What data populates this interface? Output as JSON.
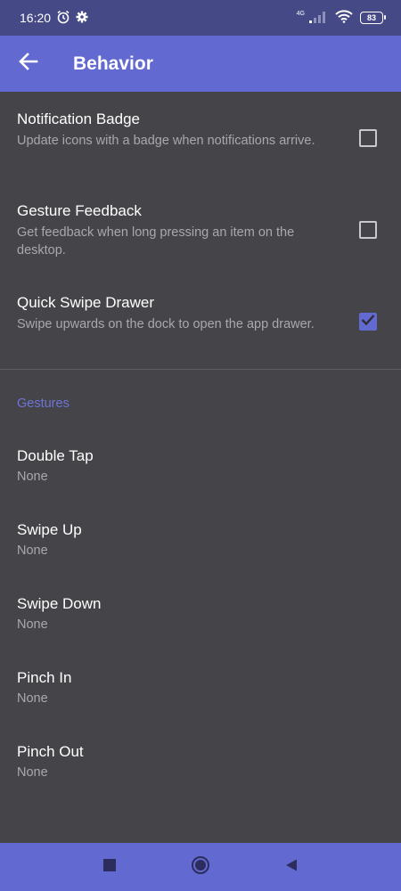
{
  "status_bar": {
    "time": "16:20",
    "network": "4G",
    "battery": "83"
  },
  "app_bar": {
    "title": "Behavior"
  },
  "settings": [
    {
      "title": "Notification Badge",
      "summary": "Update icons with a badge when notifications arrive.",
      "checked": false
    },
    {
      "title": "Gesture Feedback",
      "summary": "Get feedback when long pressing an item on the desktop.",
      "checked": false
    },
    {
      "title": "Quick Swipe Drawer",
      "summary": "Swipe upwards on the dock to open the app drawer.",
      "checked": true
    }
  ],
  "gestures": {
    "header": "Gestures",
    "items": [
      {
        "title": "Double Tap",
        "value": "None"
      },
      {
        "title": "Swipe Up",
        "value": "None"
      },
      {
        "title": "Swipe Down",
        "value": "None"
      },
      {
        "title": "Pinch In",
        "value": "None"
      },
      {
        "title": "Pinch Out",
        "value": "None"
      }
    ]
  },
  "colors": {
    "accent": "#6269d1",
    "status_bar": "#454a86",
    "background": "#454448",
    "section_header": "#6e74d6"
  },
  "icons": {
    "back": "arrow-left-icon",
    "alarm": "alarm-clock-icon",
    "settings": "gear-icon",
    "signal": "cell-signal-icon",
    "wifi": "wifi-icon",
    "checkmark": "checkmark-icon",
    "nav_recents": "square-icon",
    "nav_home": "circle-icon",
    "nav_back": "triangle-back-icon"
  }
}
